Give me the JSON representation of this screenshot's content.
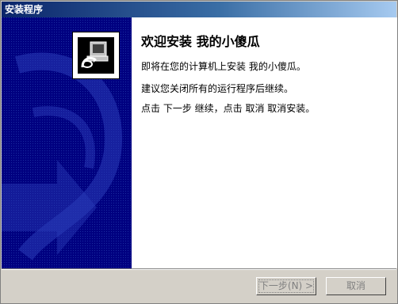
{
  "window": {
    "title": "安装程序"
  },
  "content": {
    "welcome_title": "欢迎安装 我的小傻瓜",
    "line1": "即将在您的计算机上安装 我的小傻瓜。",
    "line2": "建议您关闭所有的运行程序后继续。",
    "line3": "点击 下一步 继续，点击 取消 取消安装。"
  },
  "buttons": {
    "next_label": "下一步(N) >",
    "cancel_label": "取消"
  },
  "colors": {
    "titlebar": "#0a246a",
    "side_panel": "#000080",
    "face": "#d4d0c8"
  },
  "icons": {
    "installer": "computer-disk-icon"
  }
}
